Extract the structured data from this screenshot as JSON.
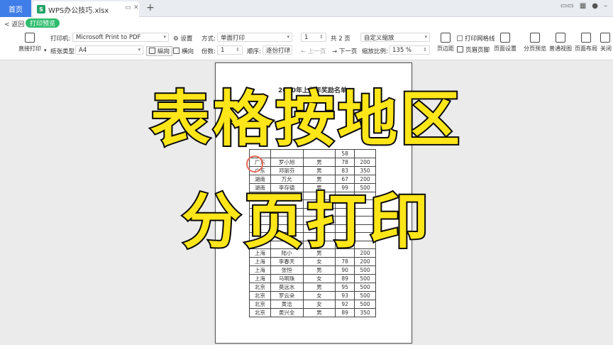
{
  "titlebar": {
    "home_tab": "首页",
    "file_tab": "WPS办公技巧.xlsx",
    "file_icon": "S",
    "add_tab": "+"
  },
  "subbar": {
    "back": "< 返回",
    "mode_tag": "打印预览"
  },
  "toolbar": {
    "direct_print": "直接打印",
    "printer_label": "打印机:",
    "printer_value": "Microsoft Print to PDF",
    "paper_label": "纸张类型:",
    "paper_value": "A4",
    "settings": "设置",
    "portrait": "纵向",
    "landscape": "横向",
    "mode_label": "方式:",
    "mode_value": "单面打印",
    "copies_label": "份数:",
    "copies_value": "1",
    "order_label": "顺序:",
    "order_value": "逐份打印",
    "page_value": "1",
    "total_pages": "共 2 页",
    "prev_page": "上一页",
    "next_page": "下一页",
    "scale_mode": "自定义缩放",
    "scale_label": "缩放比例:",
    "scale_value": "135 %",
    "margins": "页边距",
    "print_gridlines": "打印网格线",
    "header_footer": "页眉页脚",
    "page_setup": "页面设置",
    "page_break_preview": "分页预览",
    "normal_view": "普通视图",
    "page_layout": "页面布局",
    "close": "关闭"
  },
  "sheet": {
    "title": "2020年上半年奖励名单",
    "rows": [
      [
        "",
        "",
        "",
        "58",
        ""
      ],
      [
        "广东",
        "罗小旭",
        "男",
        "78",
        "200"
      ],
      [
        "广东",
        "邓丽芬",
        "男",
        "83",
        "350"
      ],
      [
        "湖南",
        "万允",
        "男",
        "67",
        "200"
      ],
      [
        "湖南",
        "李存德",
        "男",
        "99",
        "500"
      ],
      [
        "",
        "",
        "",
        "",
        ""
      ],
      [
        "",
        "",
        "",
        "",
        ""
      ],
      [
        "",
        "",
        "",
        "",
        ""
      ],
      [
        "",
        "",
        "",
        "",
        ""
      ],
      [
        "",
        "",
        "",
        "",
        ""
      ],
      [
        "",
        "",
        "",
        "",
        ""
      ],
      [
        "",
        "",
        "",
        "",
        ""
      ],
      [
        "上海",
        "陆小",
        "男",
        "",
        "200"
      ],
      [
        "上海",
        "李春天",
        "女",
        "78",
        "200"
      ],
      [
        "上海",
        "张恒",
        "男",
        "90",
        "500"
      ],
      [
        "上海",
        "马明珠",
        "女",
        "89",
        "500"
      ],
      [
        "北京",
        "莫远水",
        "男",
        "95",
        "500"
      ],
      [
        "北京",
        "罗云朵",
        "女",
        "93",
        "500"
      ],
      [
        "北京",
        "黄洁",
        "女",
        "92",
        "500"
      ],
      [
        "北京",
        "黄兴全",
        "男",
        "89",
        "350"
      ]
    ]
  },
  "overlay": {
    "line1": "表格按地区",
    "line2": "分页打印",
    "text_color": "#ffe619",
    "stroke_color": "#0d0d0d"
  },
  "colors": {
    "home_tab": "#3f7de8",
    "mode_tag": "#2dbd6c",
    "file_icon": "#21a366"
  }
}
